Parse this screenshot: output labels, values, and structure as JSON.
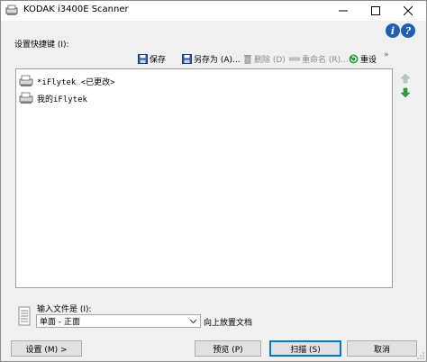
{
  "window": {
    "title": "KODAK i3400E Scanner",
    "icons": {
      "app": "scanner-app-icon",
      "minimize": "minimize-icon",
      "maximize": "maximize-icon",
      "close": "close-icon"
    }
  },
  "shortcuts": {
    "label": "设置快捷键 (I):",
    "help_icons": [
      "i",
      "?"
    ]
  },
  "toolbar": {
    "save_label": "保存",
    "saveas_label": "另存为 (A)...",
    "delete_label": "删除 (D)",
    "rename_label": "重命名 (R)...",
    "reset_label": "重设",
    "more_label": "»"
  },
  "shortcut_list": {
    "items": [
      {
        "label": "*iFlytek <已更改>"
      },
      {
        "label": "我的iFlytek"
      }
    ]
  },
  "input_document": {
    "label": "输入文件是 (I):",
    "selected_value": "单面 - 正面",
    "upward_label": "向上放置文档"
  },
  "buttons": {
    "settings_label": "设置 (M) >",
    "preview_label": "预览 (P)",
    "scan_label": "扫描 (S)",
    "cancel_label": "取消"
  },
  "colors": {
    "accent": "#0078d7",
    "help_blue": "#1f5fb6",
    "arrow_green": "#2e9e3e"
  }
}
